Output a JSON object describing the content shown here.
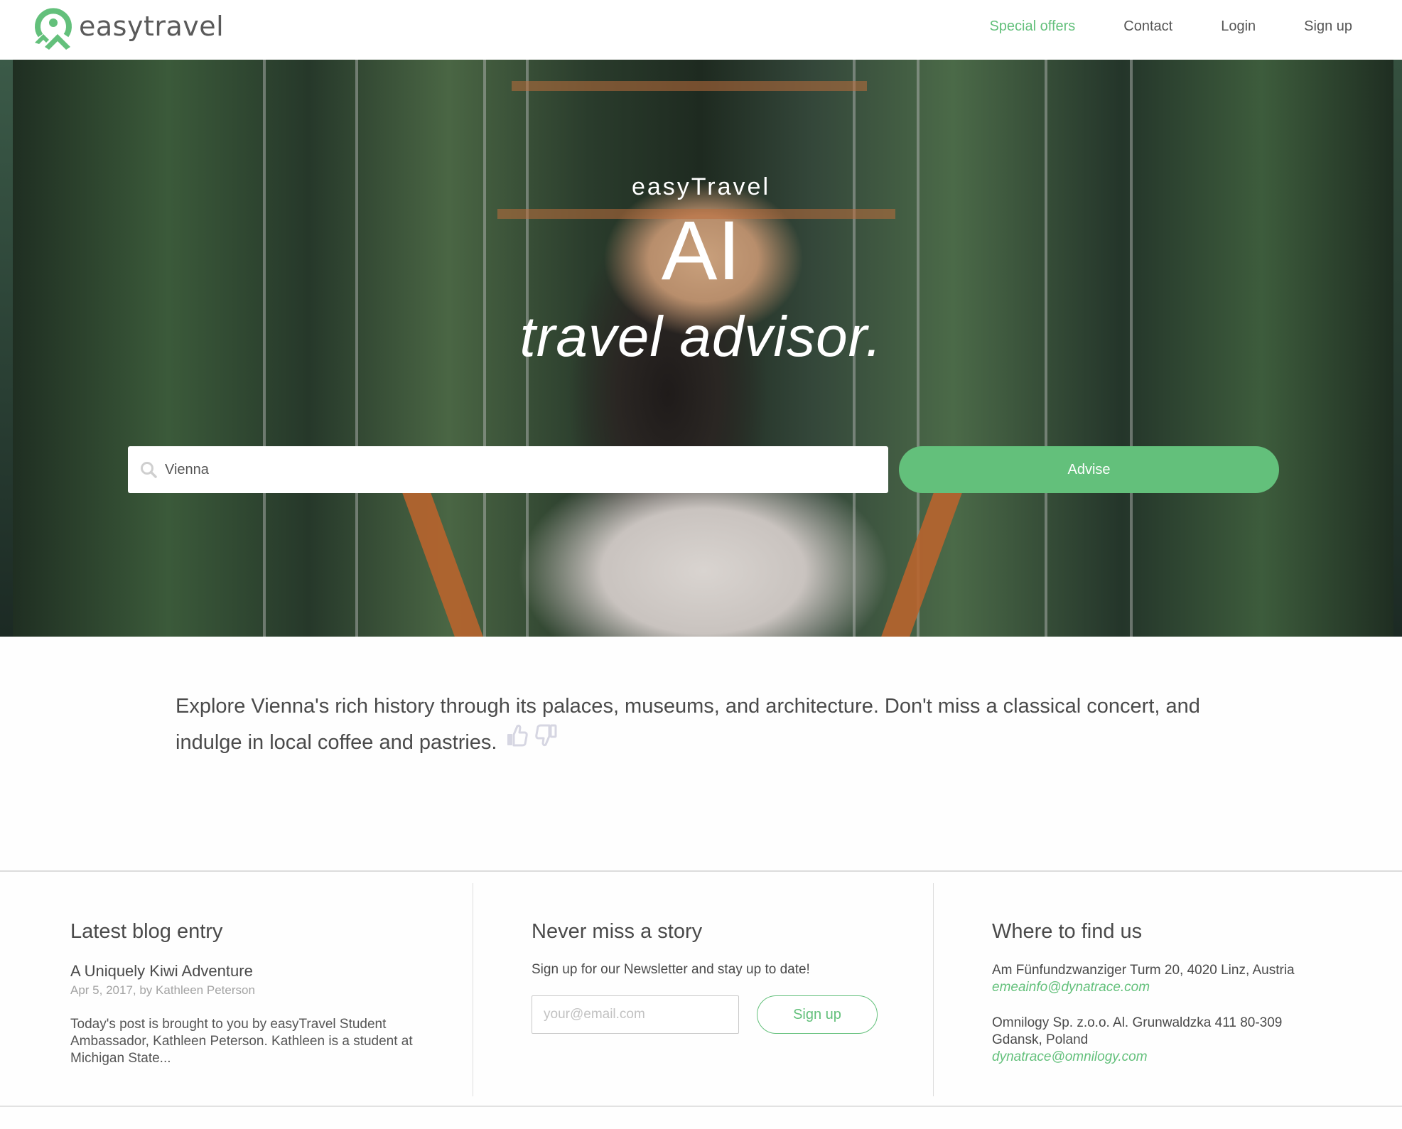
{
  "header": {
    "brand": "easytravel",
    "nav": [
      {
        "label": "Special offers",
        "active": true
      },
      {
        "label": "Contact",
        "active": false
      },
      {
        "label": "Login",
        "active": false
      },
      {
        "label": "Sign up",
        "active": false
      }
    ]
  },
  "hero": {
    "brand": "easyTravel",
    "headline": "AI",
    "tagline": "travel advisor.",
    "search": {
      "value": "Vienna",
      "icon": "search-icon"
    },
    "advise_label": "Advise"
  },
  "advice": {
    "text": "Explore Vienna's rich history through its palaces, museums, and architecture. Don't miss a classical concert, and indulge in local coffee and pastries.",
    "feedback": [
      "thumbs-up-icon",
      "thumbs-down-icon"
    ]
  },
  "footer": {
    "blog": {
      "title": "Latest blog entry",
      "post_title": "A Uniquely Kiwi Adventure",
      "meta": "Apr 5, 2017, by Kathleen Peterson",
      "excerpt": "Today's post is brought to you by easyTravel Student Ambassador, Kathleen Peterson. Kathleen is a student at Michigan State..."
    },
    "newsletter": {
      "title": "Never miss a story",
      "text": "Sign up for our Newsletter and stay up to date!",
      "email_placeholder": "your@email.com",
      "signup_label": "Sign up"
    },
    "contact": {
      "title": "Where to find us",
      "locations": [
        {
          "address": "Am Fünfundzwanziger Turm 20, 4020 Linz, Austria",
          "email": "emeainfo@dynatrace.com"
        },
        {
          "address": "Omnilogy Sp. z.o.o. Al. Grunwaldzka 411 80-309 Gdansk, Poland",
          "email": "dynatrace@omnilogy.com"
        }
      ]
    }
  },
  "colors": {
    "accent": "#63c07b",
    "text": "#4a4a4a",
    "muted": "#a3a3a3"
  }
}
